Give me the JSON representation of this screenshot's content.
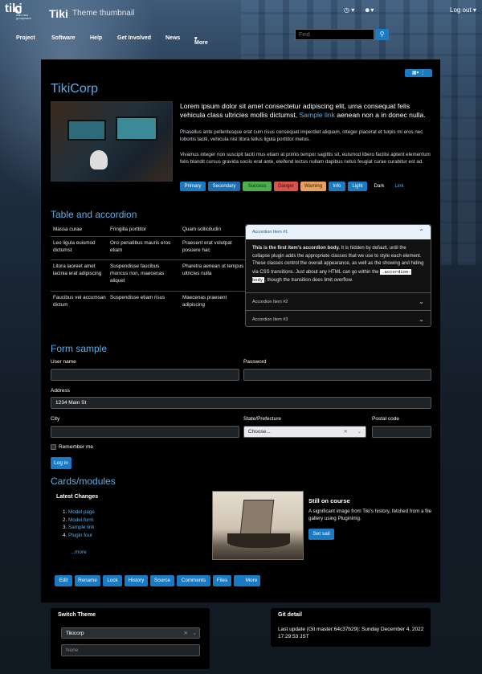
{
  "header": {
    "logo_text": "tiki",
    "logo_subtext": "wiki cms groupware",
    "brand": "Tiki",
    "subtitle": "Theme thumbnail",
    "clock_icon": "clock-icon",
    "users_icon": "users-icon",
    "logout_label": "Log out"
  },
  "nav": {
    "items": [
      "Project",
      "Software",
      "Help",
      "Get Involved",
      "News",
      "More"
    ],
    "search_placeholder": "Find",
    "search_icon": "search-icon"
  },
  "main": {
    "view_icon": "view-options-icon",
    "title": "TikiCorp",
    "lead_text": "Lorem ipsum dolor sit amet consectetur adipiscing elit, urna consequat felis vehicula class ultricies mollis dictumst,",
    "lead_link": "Sample link",
    "lead_tail": "aenean non a in donec nulla.",
    "para1": "Phasellus ante pellentesque erat cum risus consequat imperdiet aliquam, integer placerat et turpis mi eros nec lobortis taciti, vehicula nisl litora tellus ligula porttitor metus.",
    "para2": "Vivamus integer non suscipit taciti mus etiam at primis tempor sagittis sit, euismod libero facilisi aptent elementum felis blandit cursus gravida sociis erat ante, eleifend lectus nullam dapibus netus feugiat curae curabitur est ad.",
    "buttons": [
      "Primary",
      "Secondary",
      "Success",
      "Danger",
      "Warning",
      "Info",
      "Light",
      "Dark",
      "Link"
    ]
  },
  "table_section": {
    "heading": "Table and accordion",
    "rows": [
      [
        "Massa curae",
        "Fringilla porttitor",
        "Quam sollicitudin"
      ],
      [
        "Leo ligula euismod dictumst",
        "Orci penatibus mauris eros etiam",
        "Praesent erat volutpat posuere hac"
      ],
      [
        "Litora laoreet amet lacinia erat adipiscing",
        "Suspendisse faucibus rhoncus non, maecenas aliquet",
        "Pharetra aenean ut tempus ultricies nulla"
      ],
      [
        "Faucibus vel accumsan dictum",
        "Suspendisse etiam risus",
        "Maecenas praesent adipiscing"
      ]
    ],
    "accordion": {
      "item1": "Accordion Item #1",
      "body_strong": "This is the first item's accordion body.",
      "body_text": "It is hidden by default, until the collapse plugin adds the appropriate classes that we use to style each element. These classes control the overall appearance, as well as the showing and hiding via CSS transitions. Just about any HTML can go within the",
      "body_code": ".accordion-body",
      "body_tail": ", though the transition does limit overflow.",
      "item2": "Accordion Item #2",
      "item3": "Accordion Item #3"
    }
  },
  "form": {
    "heading": "Form sample",
    "username_label": "User name",
    "password_label": "Password",
    "address_label": "Address",
    "address_value": "1234 Main St",
    "city_label": "City",
    "state_label": "State/Prefecture",
    "state_value": "Choose...",
    "postal_label": "Postal code",
    "remember_label": "Remember me",
    "login_label": "Log in"
  },
  "cards": {
    "heading": "Cards/modules",
    "latest_title": "Latest Changes",
    "latest_items": [
      "Model page",
      "Model form",
      "Sample link",
      "Plugin four"
    ],
    "latest_more": "...more",
    "card2_title": "Still on course",
    "card2_text": "A significant image from Tiki's history, fetched from a file gallery using PluginImg.",
    "card2_button": "Set sail"
  },
  "toolbar": [
    "Edit",
    "Rename",
    "Lock",
    "History",
    "Source",
    "Comments",
    "Files",
    "More"
  ],
  "footer": {
    "switch_title": "Switch Theme",
    "theme_value": "Tikicorp",
    "option_value": "None",
    "git_title": "Git detail",
    "git_text": "Last update (Git master:64c37b29): Sunday December 4, 2022 17:29:53 JST"
  },
  "colors": {
    "accent": "#1a7bc2",
    "heading": "#5aaee8",
    "success": "#4caf50",
    "danger": "#d9534f",
    "warning": "#e8a05a",
    "info": "#1a7bc2",
    "secondary": "#1f6fae"
  }
}
